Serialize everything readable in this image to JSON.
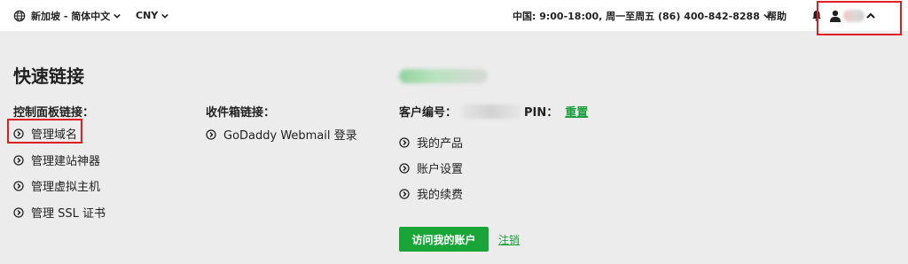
{
  "topbar": {
    "region": "新加坡 - 简体中文",
    "currency": "CNY",
    "support_hours": "中国: 9:00-18:00, 周一至周五 (86) 400-842-8288",
    "help": "帮助"
  },
  "quick_links": {
    "title": "快速链接",
    "control_panel": {
      "heading": "控制面板链接：",
      "items": [
        "管理域名",
        "管理建站神器",
        "管理虚拟主机",
        "管理 SSL 证书"
      ]
    },
    "inbox": {
      "heading": "收件箱链接：",
      "items": [
        "GoDaddy Webmail 登录"
      ]
    },
    "account": {
      "customer_label": "客户编号：",
      "pin_label": "PIN：",
      "reset_label": "重置",
      "items": [
        "我的产品",
        "账户设置",
        "我的续费"
      ],
      "visit_button": "访问我的账户",
      "logout": "注销"
    }
  },
  "colors": {
    "accent_green": "#1aa539",
    "highlight_red": "#e02020",
    "background": "#ececec"
  },
  "icons": {
    "region": "globe-icon",
    "dropdown": "chevron-down-icon",
    "notifications": "bell-icon",
    "user": "person-icon",
    "collapse": "chevron-up-icon",
    "link": "circle-chevron-icon"
  }
}
